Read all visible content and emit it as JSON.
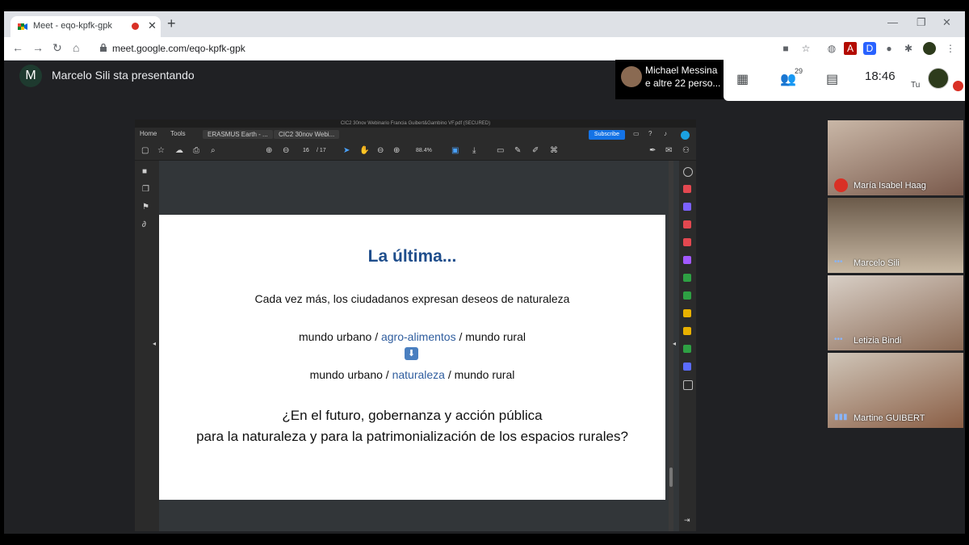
{
  "browser": {
    "tab_title": "Meet - eqo-kpfk-gpk",
    "url": "meet.google.com/eqo-kpfk-gpk"
  },
  "meet": {
    "presenter_initial": "M",
    "presenting_text": "Marcelo Sili sta presentando",
    "speaker_name": "Michael Messina",
    "speaker_others": "e altre 22 perso...",
    "participants_count": "29",
    "time": "18:46",
    "self_label": "Tu"
  },
  "acrobat": {
    "window_title": "CIC2 30nov Webinario Francia Guibert&Gambino VF.pdf (SECURED)",
    "tabs": [
      "Home",
      "Tools",
      "ERASMUS Earth - ...",
      "CIC2 30nov Webi..."
    ],
    "subscribe_label": "Subscribe",
    "page_current": "16",
    "page_total": "/ 17",
    "zoom": "88.4%"
  },
  "slide": {
    "title": "La última...",
    "line1": "Cada vez más, los ciudadanos expresan deseos de naturaleza",
    "line2_pre": "mundo urbano / ",
    "line2_hl": "agro-alimentos",
    "line2_post": " / mundo rural",
    "line3_pre": "mundo urbano / ",
    "line3_hl": "naturaleza",
    "line3_post": " / mundo rural",
    "question1": "¿En el futuro, gobernanza y acción pública",
    "question2": "para la naturaleza y para la patrimonialización de los espacios rurales?"
  },
  "participants": [
    {
      "name": "María Isabel Haag",
      "status": "muted"
    },
    {
      "name": "Marcelo Sili",
      "status": "idle"
    },
    {
      "name": "Letizia Bindi",
      "status": "idle"
    },
    {
      "name": "Martine GUIBERT",
      "status": "speaking"
    }
  ],
  "colors": {
    "accent_blue": "#1f4e8c",
    "mute_red": "#d93025",
    "subscribe_blue": "#1473e6"
  }
}
